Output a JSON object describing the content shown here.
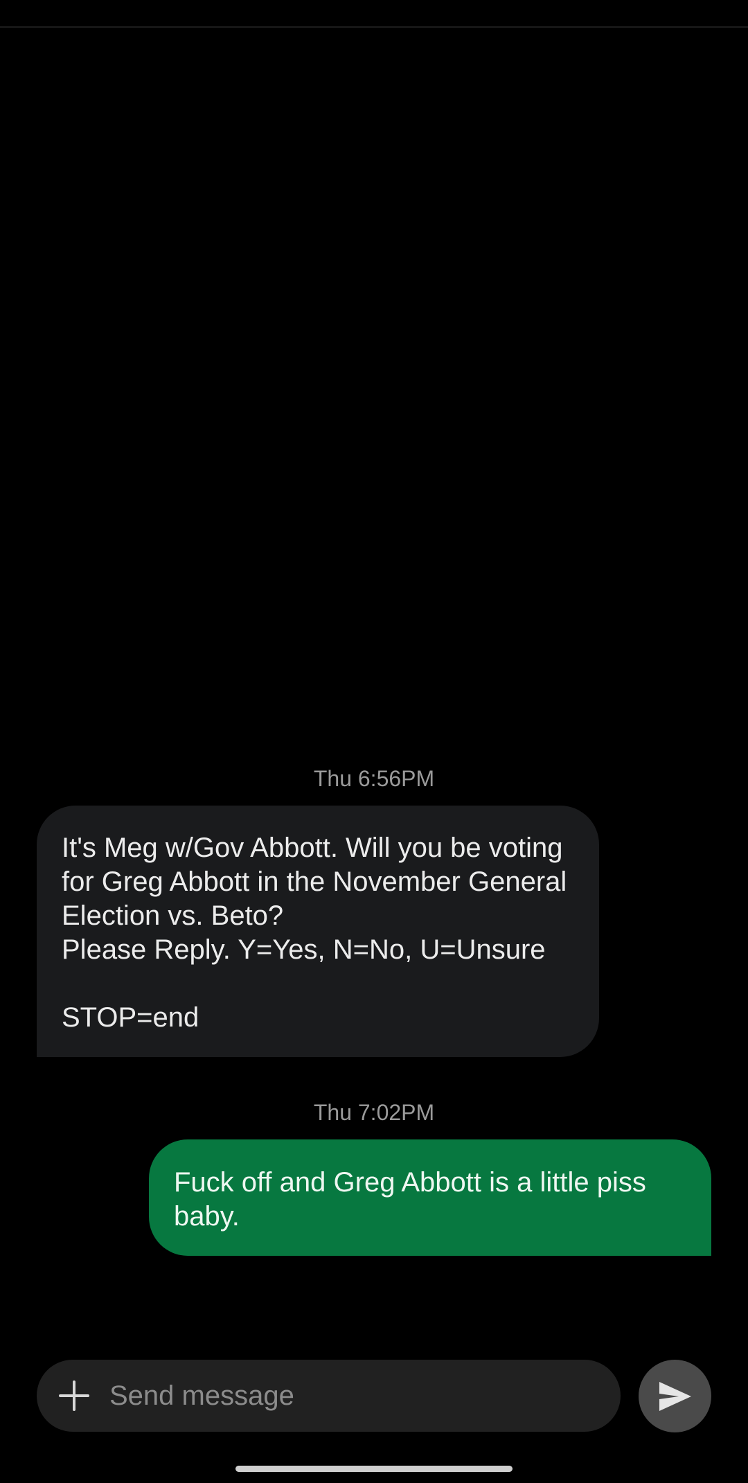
{
  "conversation": {
    "messages": [
      {
        "timestamp": "Thu 6:56PM",
        "direction": "incoming",
        "text": "It's Meg w/Gov Abbott. Will you be voting for Greg Abbott in the November General Election vs. Beto?\nPlease Reply. Y=Yes, N=No, U=Unsure\n\nSTOP=end"
      },
      {
        "timestamp": "Thu 7:02PM",
        "direction": "outgoing",
        "text": "Fuck off and Greg Abbott is a little piss baby."
      }
    ]
  },
  "composer": {
    "placeholder": "Send message",
    "value": "",
    "attach_icon": "plus-icon",
    "send_icon": "send-icon"
  },
  "colors": {
    "background": "#000000",
    "incoming_bubble": "#1a1b1d",
    "outgoing_bubble": "#077840",
    "composer_background": "#212121",
    "send_button": "#4a4a4a",
    "timestamp_text": "#9a9a9a"
  }
}
